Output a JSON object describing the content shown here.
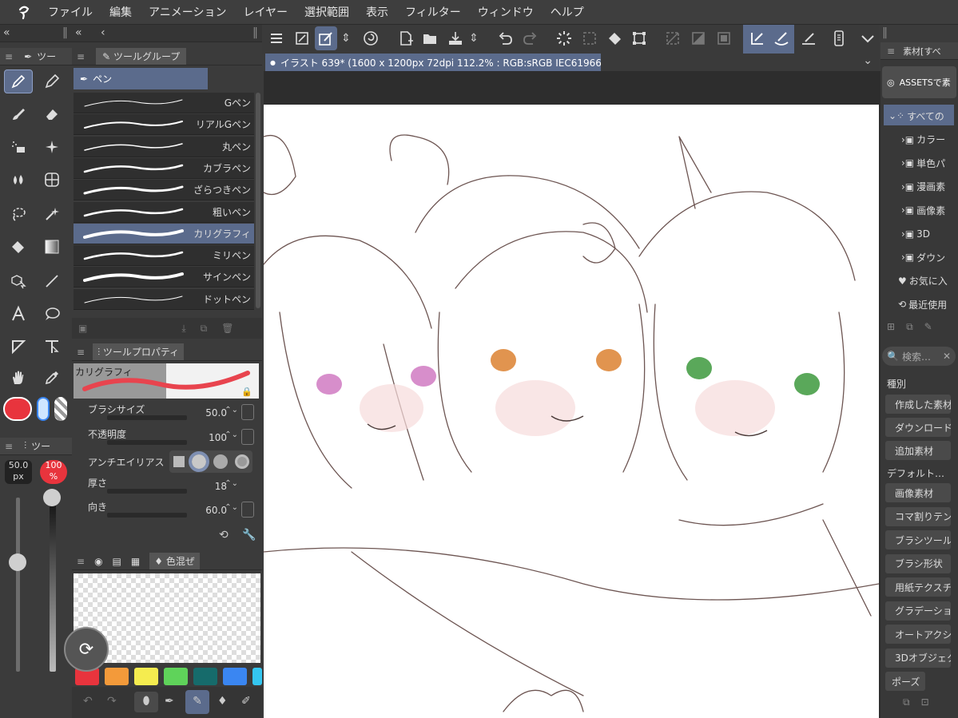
{
  "menu": [
    "ファイル",
    "編集",
    "アニメーション",
    "レイヤー",
    "選択範囲",
    "表示",
    "フィルター",
    "ウィンドウ",
    "ヘルプ"
  ],
  "tool_panel": {
    "tab_label": "ツー"
  },
  "tool_group": {
    "tab_label": "ツールグループ",
    "group_name": "ペン"
  },
  "brushes": [
    "Gペン",
    "リアルGペン",
    "丸ペン",
    "カブラペン",
    "ざらつきペン",
    "粗いペン",
    "カリグラフィ",
    "ミリペン",
    "サインペン",
    "ドットペン"
  ],
  "selected_brush": "カリグラフィ",
  "tool_property": {
    "tab_label": "ツールプロパティ",
    "preview_name": "カリグラフィ",
    "brush_size_label": "ブラシサイズ",
    "brush_size": "50.0",
    "opacity_label": "不透明度",
    "opacity": "100",
    "antialias_label": "アンチエイリアス",
    "thickness_label": "厚さ",
    "thickness": "18",
    "direction_label": "向き",
    "direction": "60.0"
  },
  "brush_size_panel": {
    "tab_label": "ツー",
    "size_line1": "50.0",
    "size_line2": "px",
    "opacity_line1": "100",
    "opacity_line2": "%"
  },
  "color_panel": {
    "tab_label": "色混ぜ"
  },
  "palette": [
    "#e8343d",
    "#f39a3a",
    "#f5ec4f",
    "#5fd35a",
    "#166b6b",
    "#3a86f2",
    "#34c6f0"
  ],
  "document_tab": "イラスト 639* (1600 x 1200px 72dpi 112.2% : RGB:sRGB IEC61966-2.1)",
  "material_panel": {
    "tab_label": "素材[すべ",
    "assets_button": "ASSETSで素",
    "tree": [
      "すべての",
      "カラー",
      "単色パ",
      "漫画素",
      "画像素",
      "3D",
      "ダウン",
      "お気に入",
      "最近使用"
    ],
    "search_placeholder": "検索…",
    "category_header": "種別",
    "category_buttons": [
      "作成した素材",
      "ダウンロード",
      "追加素材"
    ],
    "default_header": "デフォルト…",
    "default_buttons": [
      "画像素材",
      "コマ割りテン",
      "ブラシツール",
      "ブラシ形状",
      "用紙テクスチ",
      "グラデーショ",
      "オートアクシ",
      "3Dオブジェク",
      "ポーズ"
    ]
  },
  "colors": {
    "accent": "#5b6b8c",
    "main_color": "#e8343d",
    "sub_color": "#cfe6ff"
  }
}
